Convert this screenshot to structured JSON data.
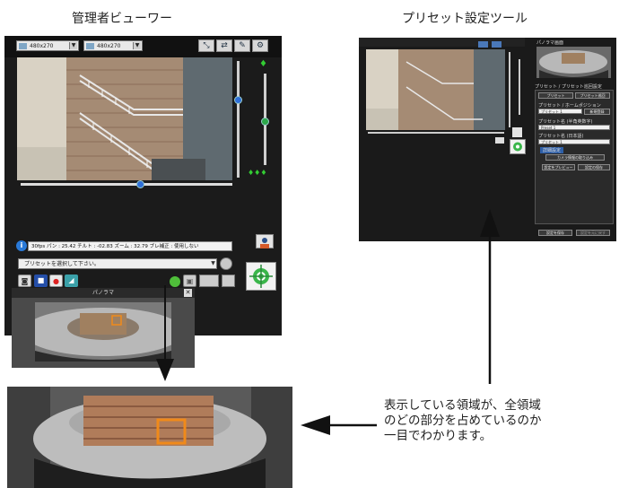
{
  "viewer": {
    "title": "管理者ビューワー",
    "resolution_a": "480x270",
    "resolution_b": "480x270",
    "status_text": "30fps パン : 25.42 チルト : -02.83 ズーム : 32.79 ブレ補正 : 使用しない",
    "preset_placeholder": "プリセットを選択して下さい。",
    "panorama_title": "パノラマ"
  },
  "preset_tool": {
    "title": "プリセット設定ツール",
    "panorama_label": "パノラマ画面",
    "settings_label": "プリセット / プリセット巡回設定",
    "tab_preset": "プリセット",
    "tab_tour": "プリセット巡回",
    "home_label": "プリセット / ホームポジション",
    "preset_select": "プリセット 1",
    "register_button": "新規登録",
    "name_label_en": "プリセット名 (半角英数字)",
    "name_value_en": "Preset 1",
    "name_label_ja": "プリセット名 (日本語)",
    "name_value_ja": "プリセット 1",
    "detail_label": "詳細設定",
    "current_angle_button": "カメラ情報の取り込み",
    "preview_button": "設定をプレビュー",
    "save_button": "設定の保存",
    "apply_button": "設定を保存",
    "restore_button": "設定を元に戻す"
  },
  "description": {
    "lines": [
      "表示している領域が、全領域",
      "のどの部分を占めているのか",
      "一目でわかります。"
    ]
  }
}
